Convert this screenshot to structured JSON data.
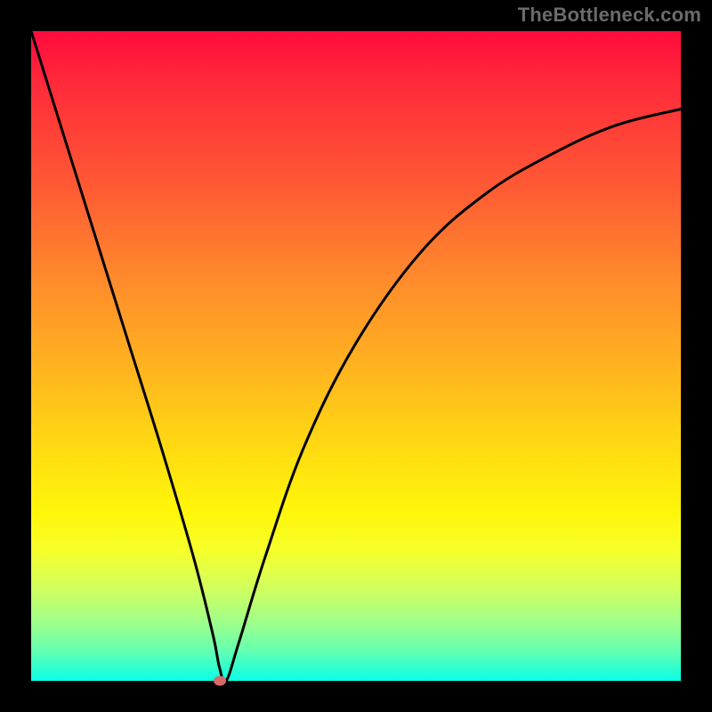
{
  "watermark": "TheBottleneck.com",
  "chart_data": {
    "type": "line",
    "title": "",
    "xlabel": "",
    "ylabel": "",
    "xlim": [
      0,
      100
    ],
    "ylim": [
      0,
      100
    ],
    "grid": false,
    "legend": false,
    "series": [
      {
        "name": "bottleneck-curve",
        "x": [
          0,
          5,
          10,
          15,
          20,
          25,
          28,
          29,
          30,
          32,
          36,
          42,
          50,
          60,
          70,
          80,
          90,
          100
        ],
        "y": [
          100,
          84,
          68,
          52,
          36,
          19,
          7,
          2,
          0,
          6,
          19,
          36,
          52,
          66,
          75,
          81,
          85.5,
          88
        ]
      }
    ],
    "marker": {
      "x": 29,
      "y": 0,
      "color": "#d46a6a"
    },
    "background_gradient": {
      "top": "#ff0a3c",
      "mid": "#ffe010",
      "bottom": "#0affe8"
    }
  }
}
